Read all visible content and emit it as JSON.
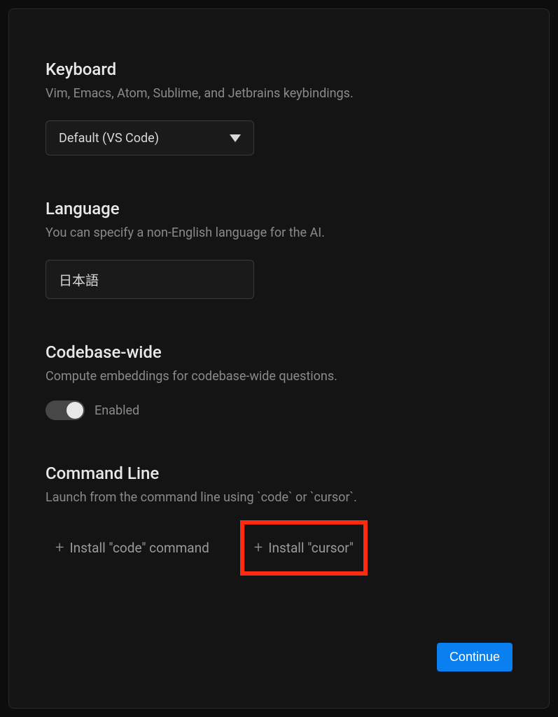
{
  "sections": {
    "keyboard": {
      "title": "Keyboard",
      "desc": "Vim, Emacs, Atom, Sublime, and Jetbrains keybindings.",
      "selected": "Default (VS Code)"
    },
    "language": {
      "title": "Language",
      "desc": "You can specify a non-English language for the AI.",
      "value": "日本語"
    },
    "codebase": {
      "title": "Codebase-wide",
      "desc": "Compute embeddings for codebase-wide questions.",
      "toggle_label": "Enabled"
    },
    "command_line": {
      "title": "Command Line",
      "desc": "Launch from the command line using `code` or `cursor`.",
      "install_code": "Install \"code\" command",
      "install_cursor": "Install \"cursor\""
    }
  },
  "footer": {
    "continue": "Continue"
  }
}
